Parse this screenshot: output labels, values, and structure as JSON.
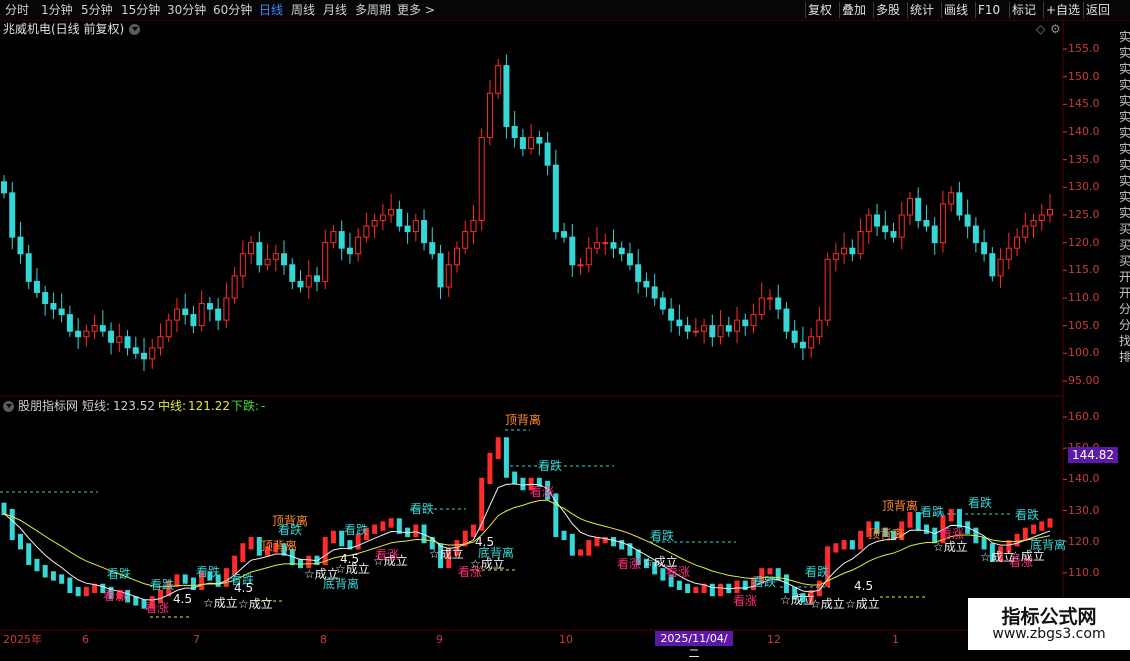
{
  "toolbar": {
    "left_items": [
      "分时",
      "1分钟",
      "5分钟",
      "15分钟",
      "30分钟",
      "60分钟",
      "日线",
      "周线",
      "月线",
      "多周期",
      "更多 >"
    ],
    "active": "日线",
    "right_items": [
      "复权",
      "叠加",
      "多股",
      "统计",
      "画线",
      "F10",
      "标记",
      "+自选",
      "返回"
    ]
  },
  "stock": {
    "title": "兆威机电(日线 前复权)"
  },
  "main_axis": {
    "ticks": [
      "155.0",
      "150.0",
      "145.0",
      "140.0",
      "135.0",
      "130.0",
      "125.0",
      "120.0",
      "115.0",
      "110.0",
      "105.0",
      "100.0",
      "95.00"
    ]
  },
  "indicator": {
    "title": "股朋指标网",
    "short_label": "短线:",
    "short_value": "123.52",
    "mid_label": "中线:",
    "mid_value": "121.22",
    "down_label": "下跌:",
    "down_value": "-",
    "axis_ticks": [
      "160.0",
      "150.0",
      "140.0",
      "130.0",
      "120.0",
      "110.0",
      "100.0"
    ],
    "price_tag": "144.82"
  },
  "x_axis": {
    "labels": [
      "2025年",
      "6",
      "7",
      "8",
      "9",
      "10",
      "11",
      "12",
      "1"
    ],
    "cursor_date": "2025/11/04/二"
  },
  "annotations": {
    "top_div": "顶背离",
    "bottom_div": "底背离",
    "fall": "看跌",
    "rise": "看涨",
    "ok": "☆成立",
    "num": "4.5"
  },
  "watermark": {
    "line1": "指标公式网",
    "line2": "www.zbgs3.com"
  },
  "right_edge_chars": [
    "实",
    "实",
    "实",
    "实",
    "实",
    "实",
    "实",
    "实",
    "实",
    "实",
    "实",
    "实",
    "买",
    "买",
    "买",
    "开",
    "开",
    "分",
    "分",
    "找",
    "排"
  ],
  "colors": {
    "up": "#ff2a2a",
    "down": "#34d6d6",
    "short_line": "#f0f0f0",
    "mid_line": "#e8e83a",
    "axis": "#c83c3c",
    "accent": "#5b1ba8"
  },
  "chart_data": {
    "type": "candlestick",
    "title": "兆威机电(日线 前复权)",
    "ylim": [
      95,
      157
    ],
    "closes": [
      129,
      121,
      118,
      113,
      111,
      109,
      108,
      107,
      104,
      103,
      104,
      105,
      104,
      102,
      103,
      101,
      100,
      99,
      101,
      103,
      106,
      108,
      107,
      105,
      109,
      108,
      106,
      110,
      114,
      118,
      120,
      116,
      117,
      118,
      116,
      113,
      112,
      114,
      113,
      120,
      122,
      119,
      118,
      121,
      123,
      124,
      125,
      126,
      123,
      122,
      124,
      120,
      118,
      112,
      116,
      119,
      122,
      124,
      139,
      147,
      152,
      141,
      139,
      137,
      139,
      138,
      134,
      122,
      121,
      116,
      116,
      119,
      120,
      120,
      119,
      118,
      116,
      113,
      112,
      110,
      108,
      106,
      105,
      104,
      104,
      105,
      103,
      105,
      104,
      106,
      105,
      107,
      110,
      110,
      108,
      104,
      102,
      101,
      103,
      106,
      117,
      118,
      119,
      118,
      122,
      125,
      123,
      122,
      121,
      125,
      128,
      124,
      123,
      120,
      127,
      129,
      125,
      123,
      120,
      118,
      114,
      117,
      119,
      121,
      123,
      124,
      125,
      126
    ],
    "short_line": "123.52",
    "mid_line": "121.22"
  }
}
